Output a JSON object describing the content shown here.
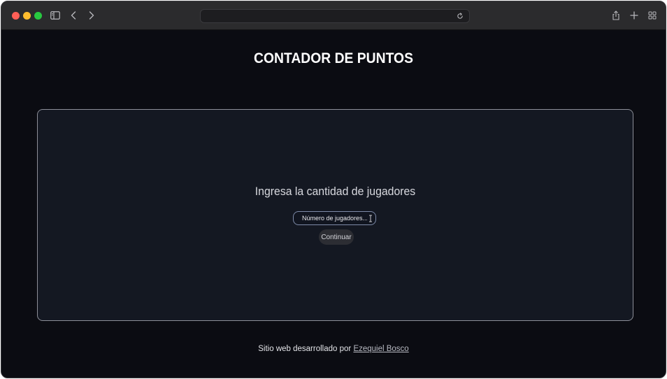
{
  "browser": {
    "url": "",
    "icons": {
      "sidebar": "sidebar-icon",
      "back": "chevron-left-icon",
      "forward": "chevron-right-icon",
      "reload": "reload-icon",
      "share": "share-icon",
      "new_tab": "plus-icon",
      "tab_overview": "tab-overview-icon"
    }
  },
  "page": {
    "title": "CONTADOR DE PUNTOS",
    "card": {
      "prompt": "Ingresa la cantidad de jugadores",
      "input_placeholder": "Número de jugadores...",
      "input_value": "",
      "continue_label": "Continuar"
    },
    "footer": {
      "prefix": "Sitio web desarrollado por",
      "author_link": "Ezequiel Bosco"
    }
  },
  "colors": {
    "page_background": "#0b0c12",
    "card_background": "#141822",
    "card_border": "#8d8f98",
    "titlebar": "#2b2b2d"
  }
}
